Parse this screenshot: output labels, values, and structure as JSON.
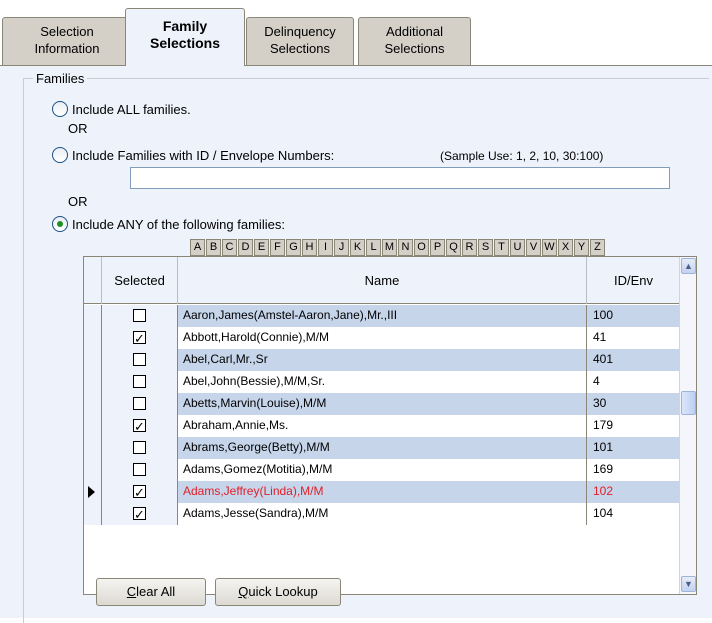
{
  "tabs": [
    {
      "line1": "Selection",
      "line2": "Information"
    },
    {
      "line1": "Family",
      "line2": "Selections"
    },
    {
      "line1": "Delinquency",
      "line2": "Selections"
    },
    {
      "line1": "Additional",
      "line2": "Selections"
    }
  ],
  "families": {
    "legend": "Families",
    "option_all": "Include ALL families.",
    "or1": "OR",
    "option_ids": "Include Families with ID / Envelope Numbers:",
    "sample_use": "(Sample Use: 1, 2, 10, 30:100)",
    "id_input_value": "",
    "or2": "OR",
    "option_any": "Include ANY of the following families:",
    "selected_option": "option_any"
  },
  "alphabet": [
    "A",
    "B",
    "C",
    "D",
    "E",
    "F",
    "G",
    "H",
    "I",
    "J",
    "K",
    "L",
    "M",
    "N",
    "O",
    "P",
    "Q",
    "R",
    "S",
    "T",
    "U",
    "V",
    "W",
    "X",
    "Y",
    "Z"
  ],
  "grid": {
    "columns": {
      "selected": "Selected",
      "name": "Name",
      "id": "ID/Env"
    },
    "rows": [
      {
        "selected": false,
        "name": "Aaron,James(Amstel-Aaron,Jane),Mr.,III",
        "id": "100"
      },
      {
        "selected": true,
        "name": "Abbott,Harold(Connie),M/M",
        "id": "41"
      },
      {
        "selected": false,
        "name": "Abel,Carl,Mr.,Sr",
        "id": "401"
      },
      {
        "selected": false,
        "name": "Abel,John(Bessie),M/M,Sr.",
        "id": "4"
      },
      {
        "selected": false,
        "name": "Abetts,Marvin(Louise),M/M",
        "id": "30"
      },
      {
        "selected": true,
        "name": "Abraham,Annie,Ms.",
        "id": "179"
      },
      {
        "selected": false,
        "name": "Abrams,George(Betty),M/M",
        "id": "101"
      },
      {
        "selected": false,
        "name": "Adams,Gomez(Motitia),M/M",
        "id": "169"
      },
      {
        "selected": true,
        "name": "Adams,Jeffrey(Linda),M/M",
        "id": "102",
        "current": true
      },
      {
        "selected": true,
        "name": "Adams,Jesse(Sandra),M/M",
        "id": "104"
      }
    ]
  },
  "buttons": {
    "clear_all_u": "C",
    "clear_all_rest": "lear All",
    "quick_lookup_u": "Q",
    "quick_lookup_rest": "uick Lookup"
  },
  "colors": {
    "current_row_text": "#e0202a",
    "alt_row": "#c6d5ea",
    "panel": "#eef2fb"
  }
}
